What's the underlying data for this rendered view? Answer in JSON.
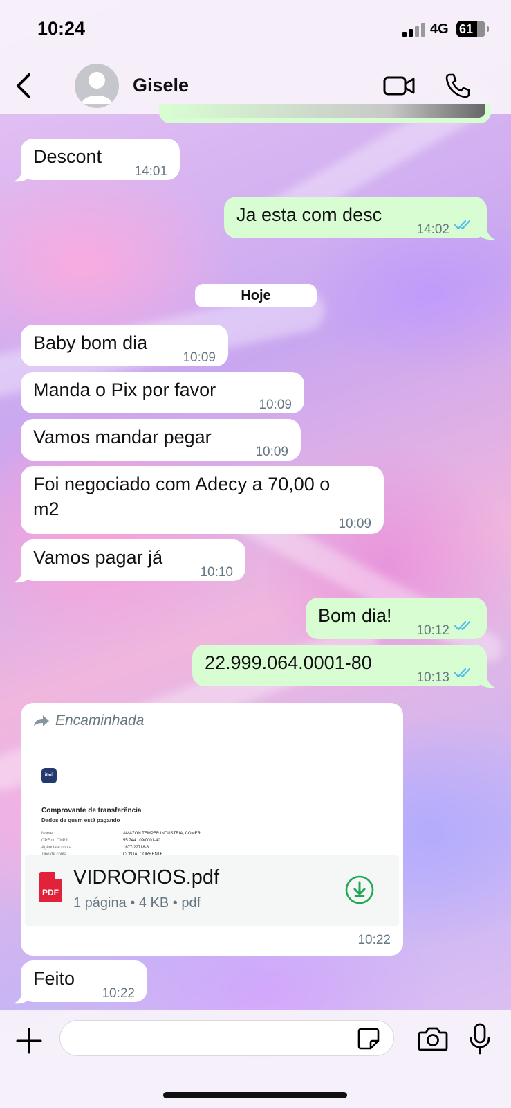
{
  "status_bar": {
    "time": "10:24",
    "network": "4G",
    "battery": "61"
  },
  "header": {
    "contact_name": "Gisele"
  },
  "day_separator": "Hoje",
  "messages": [
    {
      "direction": "in",
      "text": "Descont",
      "time": "14:01"
    },
    {
      "direction": "out",
      "text": "Ja esta com desc",
      "time": "14:02",
      "read": true
    },
    {
      "direction": "in",
      "text": "Baby bom dia",
      "time": "10:09"
    },
    {
      "direction": "in",
      "text": "Manda o Pix por favor",
      "time": "10:09"
    },
    {
      "direction": "in",
      "text": "Vamos mandar pegar",
      "time": "10:09"
    },
    {
      "direction": "in",
      "text_line1": "Foi negociado com Adecy a 70,00 o",
      "text_line2": "m2",
      "time": "10:09"
    },
    {
      "direction": "in",
      "text": "Vamos pagar já",
      "time": "10:10"
    },
    {
      "direction": "out",
      "text": "Bom dia!",
      "time": "10:12",
      "read": true
    },
    {
      "direction": "out",
      "text": "22.999.064.0001-80",
      "time": "10:13",
      "read": true
    },
    {
      "direction": "in",
      "text": "Feito",
      "time": "10:22"
    }
  ],
  "forwarded_document": {
    "forwarded_label": "Encaminhada",
    "preview": {
      "logo_text": "itaú",
      "title": "Comprovante de transferência",
      "subtitle": "Dados de quem está pagando",
      "rows": [
        {
          "label": "Nome",
          "value": "AMAZON TEMPER INDUSTRIA, COMER"
        },
        {
          "label": "CPF ou CNPJ",
          "value": "55.744.109/0001-40"
        },
        {
          "label": "Agência e conta",
          "value": "1677/22718-8"
        },
        {
          "label": "Tipo de conta",
          "value": "CONTA_CORRENTE"
        }
      ]
    },
    "file_name": "VIDRORIOS.pdf",
    "file_meta": "1 página • 4 KB • pdf",
    "file_type_badge": "PDF",
    "time": "10:22"
  },
  "colors": {
    "incoming_bubble": "#ffffff",
    "outgoing_bubble": "#d9fdd3",
    "read_ticks": "#53bdeb",
    "download_icon": "#1da851",
    "pdf_badge": "#e0233b"
  },
  "icons": {
    "back": "chevron-left-icon",
    "video": "video-camera-icon",
    "call": "phone-icon",
    "forwarded": "forward-arrow-icon",
    "download": "download-icon",
    "attach": "plus-icon",
    "sticker": "sticker-icon",
    "camera": "camera-icon",
    "mic": "microphone-icon"
  },
  "composer": {
    "placeholder": ""
  }
}
